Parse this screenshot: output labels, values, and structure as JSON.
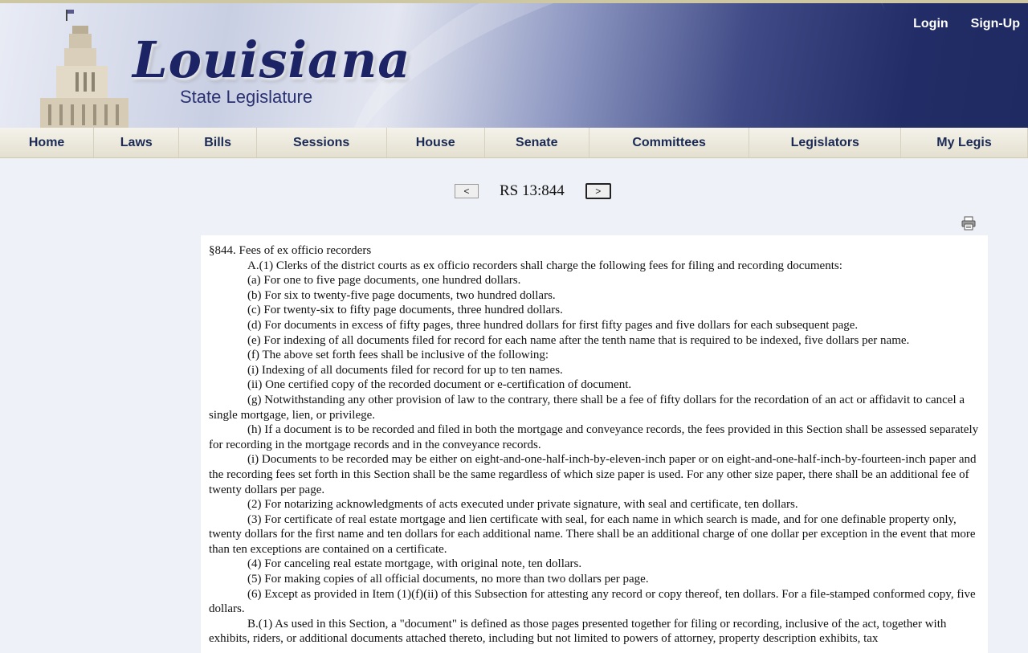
{
  "header": {
    "logo_title": "Louisiana",
    "logo_subtitle": "State Legislature",
    "login": "Login",
    "signup": "Sign-Up"
  },
  "nav": [
    {
      "label": "Home",
      "width": 117
    },
    {
      "label": "Laws",
      "width": 106
    },
    {
      "label": "Bills",
      "width": 96
    },
    {
      "label": "Sessions",
      "width": 162
    },
    {
      "label": "House",
      "width": 122
    },
    {
      "label": "Senate",
      "width": 130
    },
    {
      "label": "Committees",
      "width": 200
    },
    {
      "label": "Legislators",
      "width": 189
    },
    {
      "label": "My Legis",
      "width": 158
    }
  ],
  "pager": {
    "prev": "<",
    "title": "RS 13:844",
    "next": ">"
  },
  "document": {
    "heading": "§844. Fees of ex officio recorders",
    "paragraphs": [
      "A.(1) Clerks of the district courts as ex officio recorders shall charge the following fees for filing and recording documents:",
      "(a) For one to five page documents, one hundred dollars.",
      "(b) For six to twenty-five page documents, two hundred dollars.",
      "(c) For twenty-six to fifty page documents, three hundred dollars.",
      "(d) For documents in excess of fifty pages, three hundred dollars for first fifty pages and five dollars for each subsequent page.",
      "(e) For indexing of all documents filed for record for each name after the tenth name that is required to be indexed, five dollars per name.",
      "(f) The above set forth fees shall be inclusive of the following:",
      "(i) Indexing of all documents filed for record for up to ten names.",
      "(ii) One certified copy of the recorded document or e-certification of document.",
      "(g) Notwithstanding any other provision of law to the contrary, there shall be a fee of fifty dollars for the recordation of an act or affidavit to cancel a single mortgage, lien, or privilege.",
      "(h) If a document is to be recorded and filed in both the mortgage and conveyance records, the fees provided in this Section shall be assessed separately for recording in the mortgage records and in the conveyance records.",
      "(i) Documents to be recorded may be either on eight-and-one-half-inch-by-eleven-inch paper or on eight-and-one-half-inch-by-fourteen-inch paper and the recording fees set forth in this Section shall be the same regardless of which size paper is used. For any other size paper, there shall be an additional fee of twenty dollars per page.",
      "(2) For notarizing acknowledgments of acts executed under private signature, with seal and certificate, ten dollars.",
      "(3) For certificate of real estate mortgage and lien certificate with seal, for each name in which search is made, and for one definable property only, twenty dollars for the first name and ten dollars for each additional name. There shall be an additional charge of one dollar per exception in the event that more than ten exceptions are contained on a certificate.",
      "(4) For canceling real estate mortgage, with original note, ten dollars.",
      "(5) For making copies of all official documents, no more than two dollars per page.",
      "(6) Except as provided in Item (1)(f)(ii) of this Subsection for attesting any record or copy thereof, ten dollars. For a file-stamped conformed copy, five dollars.",
      "B.(1) As used in this Section, a \"document\" is defined as those pages presented together for filing or recording, inclusive of the act, together with exhibits, riders, or additional documents attached thereto, including but not limited to powers of attorney, property description exhibits, tax"
    ]
  }
}
